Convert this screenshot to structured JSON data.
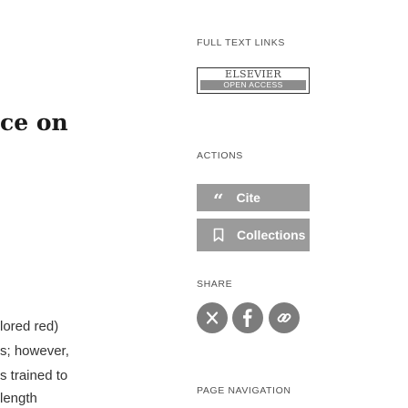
{
  "article": {
    "title_fragment": "ce on",
    "body_lines": [
      "lored red)",
      "s; however,",
      "s trained to",
      "length"
    ]
  },
  "sidebar": {
    "full_text_links": {
      "label": "FULL TEXT LINKS",
      "badge_brand": "ELSEVIER",
      "badge_sub": "OPEN ACCESS"
    },
    "actions": {
      "label": "ACTIONS",
      "cite_label": "Cite",
      "collections_label": "Collections"
    },
    "share": {
      "label": "SHARE",
      "buttons": [
        "x-icon",
        "facebook-icon",
        "link-icon"
      ]
    },
    "page_navigation": {
      "label": "PAGE NAVIGATION"
    }
  },
  "colors": {
    "button_gray": "#9b9b9b",
    "share_gray": "#7c7c7c",
    "label_gray": "#505050"
  }
}
